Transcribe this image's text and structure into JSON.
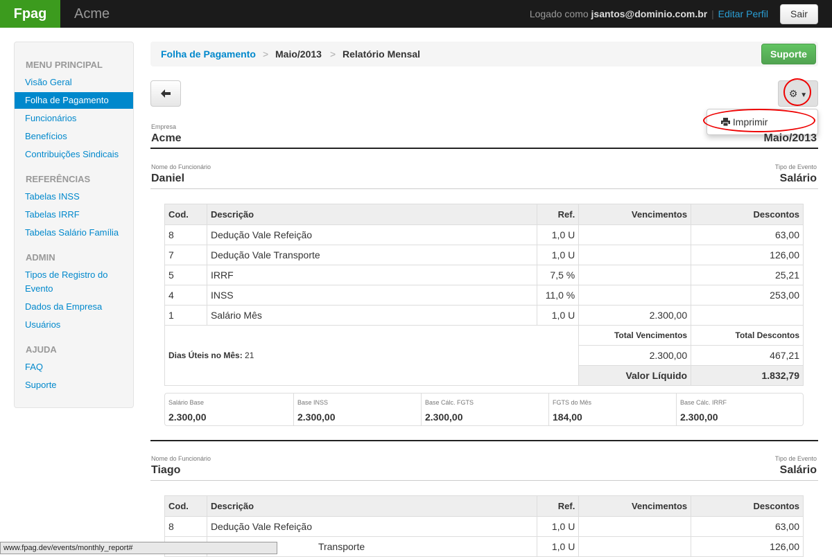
{
  "topbar": {
    "brand": "Fpag",
    "company": "Acme",
    "logged_as": "Logado como",
    "user": "jsantos@dominio.com.br",
    "sep": "|",
    "edit_profile": "Editar Perfil",
    "logout": "Sair"
  },
  "sidebar": {
    "sections": [
      {
        "header": "MENU PRINCIPAL",
        "items": [
          "Visão Geral",
          "Folha de Pagamento",
          "Funcionários",
          "Benefícios",
          "Contribuições Sindicais"
        ]
      },
      {
        "header": "REFERÊNCIAS",
        "items": [
          "Tabelas INSS",
          "Tabelas IRRF",
          "Tabelas Salário Família"
        ]
      },
      {
        "header": "ADMIN",
        "items": [
          "Tipos de Registro do",
          "Evento",
          "Dados da Empresa",
          "Usuários"
        ]
      },
      {
        "header": "AJUDA",
        "items": [
          "FAQ",
          "Suporte"
        ]
      }
    ],
    "active": "Folha de Pagamento"
  },
  "breadcrumb": {
    "root": "Folha de Pagamento",
    "sep": ">",
    "period": "Maio/2013",
    "current": "Relatório Mensal"
  },
  "support_button": "Suporte",
  "back_icon": "arrow-left-icon",
  "gear_icon": "gear-icon",
  "dropdown": {
    "print_icon": "printer-icon",
    "print": "Imprimir"
  },
  "header": {
    "company_label": "Empresa",
    "company": "Acme",
    "period": "Maio/2013"
  },
  "employees": [
    {
      "name_label": "Nome do Funcionário",
      "name": "Daniel",
      "event_label": "Tipo de Evento",
      "event": "Salário",
      "columns": [
        "Cod.",
        "Descrição",
        "Ref.",
        "Vencimentos",
        "Descontos"
      ],
      "rows": [
        [
          "8",
          "Dedução Vale Refeição",
          "1,0 U",
          "",
          "63,00"
        ],
        [
          "7",
          "Dedução Vale Transporte",
          "1,0 U",
          "",
          "126,00"
        ],
        [
          "5",
          "IRRF",
          "7,5 %",
          "",
          "25,21"
        ],
        [
          "4",
          "INSS",
          "11,0 %",
          "",
          "253,00"
        ],
        [
          "1",
          "Salário Mês",
          "1,0 U",
          "2.300,00",
          ""
        ]
      ],
      "dias_label": "Dias Úteis no Mês:",
      "dias": "21",
      "total_venc_label": "Total Vencimentos",
      "total_desc_label": "Total Descontos",
      "total_venc": "2.300,00",
      "total_desc": "467,21",
      "liquido_label": "Valor Líquido",
      "liquido": "1.832,79",
      "bases": [
        {
          "label": "Salário Base",
          "value": "2.300,00"
        },
        {
          "label": "Base INSS",
          "value": "2.300,00"
        },
        {
          "label": "Base Cálc. FGTS",
          "value": "2.300,00"
        },
        {
          "label": "FGTS do Mês",
          "value": "184,00"
        },
        {
          "label": "Base Cálc. IRRF",
          "value": "2.300,00"
        }
      ]
    },
    {
      "name_label": "Nome do Funcionário",
      "name": "Tiago",
      "event_label": "Tipo de Evento",
      "event": "Salário",
      "columns": [
        "Cod.",
        "Descrição",
        "Ref.",
        "Vencimentos",
        "Descontos"
      ],
      "rows": [
        [
          "8",
          "Dedução Vale Refeição",
          "1,0 U",
          "",
          "63,00"
        ],
        [
          "",
          "Transporte",
          "1,0 U",
          "",
          "126,00"
        ]
      ]
    }
  ],
  "statusbar": "www.fpag.dev/events/monthly_report#"
}
